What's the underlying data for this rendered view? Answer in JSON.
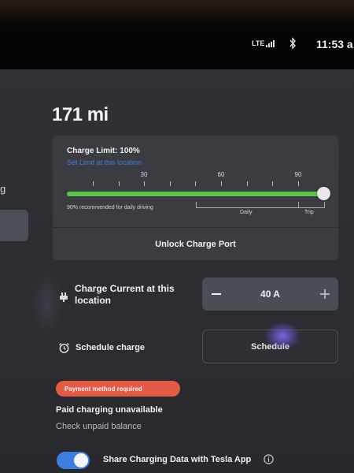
{
  "status": {
    "network": "LTE",
    "time": "11:53 a"
  },
  "sidebar": {
    "fragment_label": "g"
  },
  "range": "171 mi",
  "charge_card": {
    "limit_label": "Charge Limit: 100%",
    "set_limit_link": "Set Limit at this location",
    "ticks": [
      "30",
      "60",
      "90"
    ],
    "charge_limit_percent": 100,
    "recommendation": "90% recommended for daily driving",
    "daily_label": "Daily",
    "trip_label": "Trip",
    "unlock_button": "Unlock Charge Port"
  },
  "charge_current": {
    "label": "Charge Current at this location",
    "value": "40 A"
  },
  "schedule": {
    "label": "Schedule charge",
    "button": "Schedule"
  },
  "payment": {
    "badge": "Payment method required",
    "status": "Paid charging unavailable",
    "link": "Check unpaid balance"
  },
  "share": {
    "label": "Share Charging Data with Tesla App",
    "enabled": true
  },
  "colors": {
    "accent_blue": "#3d7ee0",
    "charge_green": "#57c848",
    "warning_red": "#e35b45"
  }
}
